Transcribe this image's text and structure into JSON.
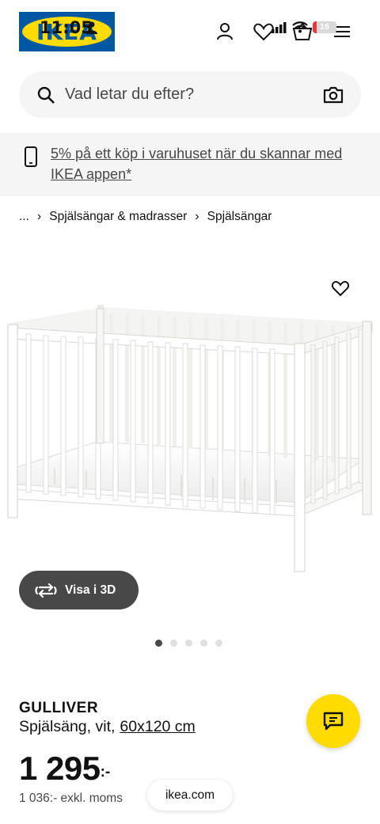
{
  "status_bar": {
    "time": "11:05",
    "battery_text": "16",
    "battery_level": 0.16,
    "icons": [
      "person-icon",
      "signal-icon",
      "wifi-icon",
      "battery-icon"
    ]
  },
  "header": {
    "logo_text": "IKEA",
    "icons": [
      "account-icon",
      "favorites-icon",
      "cart-icon",
      "menu-icon"
    ]
  },
  "search": {
    "placeholder": "Vad letar du efter?"
  },
  "promo": {
    "text": "5% på ett köp i varuhuset när du skannar med IKEA appen*"
  },
  "breadcrumb": {
    "items": [
      "...",
      "Spjälsängar & madrasser",
      "Spjälsängar"
    ]
  },
  "gallery": {
    "view3d_label": "Visa i 3D",
    "image_count": 5,
    "active_index": 0
  },
  "product": {
    "name": "GULLIVER",
    "description": "Spjälsäng, vit,",
    "size": "60x120 cm",
    "price": "1 295",
    "price_suffix": ":-",
    "price_ex_vat": "1 036:- exkl. moms"
  },
  "browser": {
    "url": "ikea.com"
  },
  "colors": {
    "ikea_blue": "#0058a3",
    "ikea_yellow": "#ffdb00",
    "dark_gray": "#484848",
    "light_gray": "#f5f5f5"
  }
}
